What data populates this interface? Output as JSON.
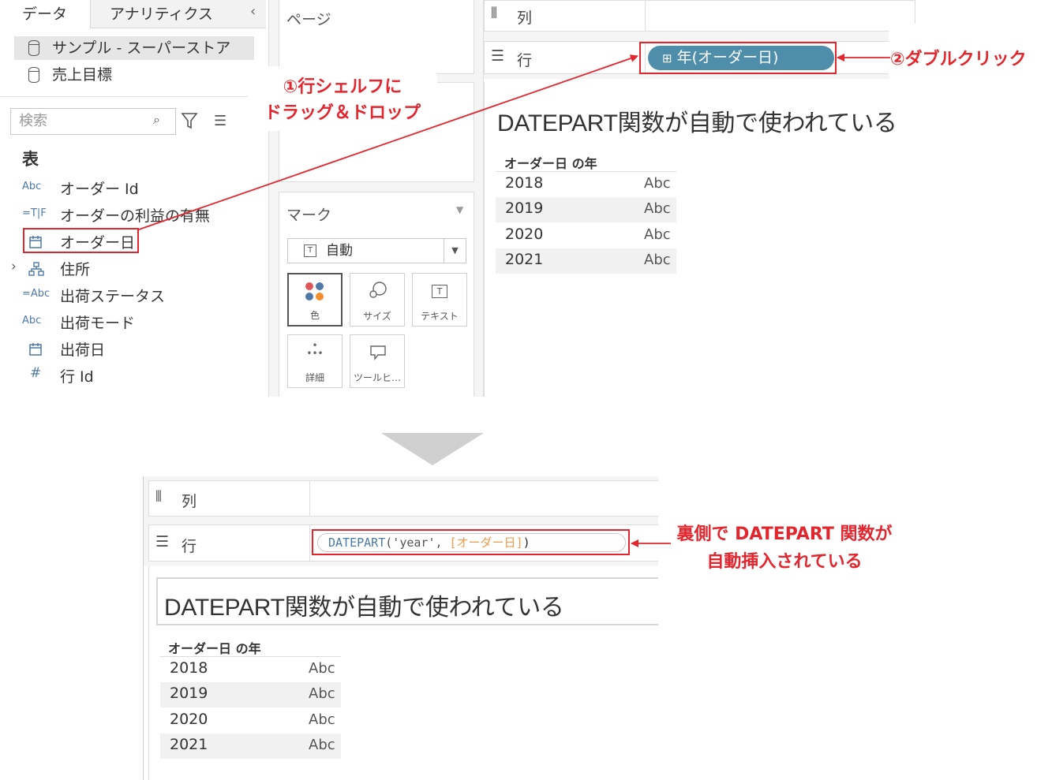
{
  "top_screen": {
    "data_pane": {
      "tab_data": "データ",
      "tab_analytics": "アナリティクス",
      "datasources": [
        "サンプル - スーパーストア",
        "売上目標"
      ],
      "search_placeholder": "検索",
      "table_heading": "表",
      "fields": [
        {
          "type": "Abc",
          "label": "オーダー Id"
        },
        {
          "type": "=T|F",
          "label": "オーダーの利益の有無"
        },
        {
          "type": "calendar",
          "label": "オーダー日"
        },
        {
          "type": "hierarchy",
          "label": "住所"
        },
        {
          "type": "=Abc",
          "label": "出荷ステータス"
        },
        {
          "type": "Abc",
          "label": "出荷モード"
        },
        {
          "type": "calendar",
          "label": "出荷日"
        },
        {
          "type": "#",
          "label": "行 Id"
        }
      ]
    },
    "cards": {
      "pages_label": "ページ",
      "marks_label": "マーク",
      "mark_type": "自動",
      "mark_buttons": [
        "色",
        "サイズ",
        "テキスト",
        "詳細",
        "ツールヒ…"
      ]
    },
    "shelves": {
      "columns_label": "列",
      "rows_label": "行",
      "row_pill": "年(オーダー日)"
    },
    "view": {
      "title": "DATEPART関数が自動で使われている",
      "header": "オーダー日 の年",
      "rows": [
        {
          "year": "2018",
          "value": "Abc"
        },
        {
          "year": "2019",
          "value": "Abc"
        },
        {
          "year": "2020",
          "value": "Abc"
        },
        {
          "year": "2021",
          "value": "Abc"
        }
      ]
    },
    "annotations": {
      "step1_line1": "①行シェルフに",
      "step1_line2": "ドラッグ＆ドロップ",
      "step2": "②ダブルクリック"
    }
  },
  "bottom_screen": {
    "shelves": {
      "columns_label": "列",
      "rows_label": "行",
      "calc_fn": "DATEPART",
      "calc_open": "('",
      "calc_arg": "year",
      "calc_sep": "', ",
      "calc_field": "[オーダー日]",
      "calc_close": ")"
    },
    "view": {
      "title": "DATEPART関数が自動で使われている",
      "header": "オーダー日 の年",
      "rows": [
        {
          "year": "2018",
          "value": "Abc"
        },
        {
          "year": "2019",
          "value": "Abc"
        },
        {
          "year": "2020",
          "value": "Abc"
        },
        {
          "year": "2021",
          "value": "Abc"
        }
      ]
    },
    "annotation_line1": "裏側で DATEPART 関数が",
    "annotation_line2": "自動挿入されている"
  },
  "colors": {
    "annotation_red": "#e3262e",
    "pill_blue": "#4e8eab",
    "field_orange": "#f39a4b",
    "function_blue": "#4a7aa7"
  }
}
